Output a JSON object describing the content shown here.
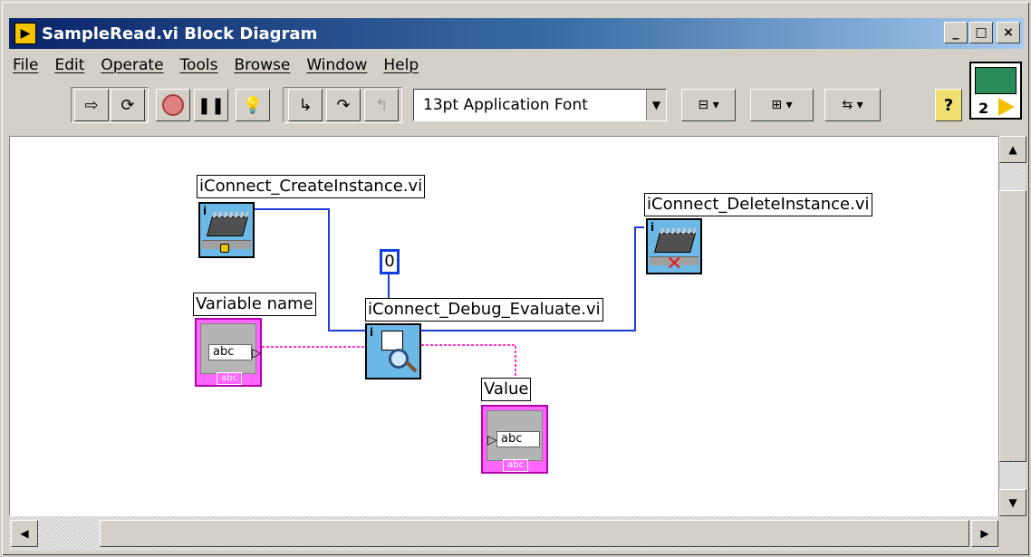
{
  "window": {
    "title": "SampleRead.vi Block Diagram",
    "controls": {
      "minimize": "_",
      "maximize": "□",
      "close": "×"
    }
  },
  "menu": [
    "File",
    "Edit",
    "Operate",
    "Tools",
    "Browse",
    "Window",
    "Help"
  ],
  "toolbar": {
    "run_icon": "run-arrow-icon",
    "run_continuous_icon": "run-continuously-icon",
    "abort_icon": "abort-icon",
    "pause_icon": "pause-icon",
    "highlight_icon": "highlight-execution-icon",
    "step_into_icon": "step-into-icon",
    "step_over_icon": "step-over-icon",
    "step_out_icon": "step-out-icon",
    "font_select": "13pt Application Font",
    "align_icon": "align-objects-icon",
    "distribute_icon": "distribute-objects-icon",
    "reorder_icon": "reorder-icon",
    "help_label": "?"
  },
  "vi_icon": {
    "number": "2"
  },
  "diagram": {
    "create_label": "iConnect_CreateInstance.vi",
    "delete_label": "iConnect_DeleteInstance.vi",
    "evaluate_label": "iConnect_Debug_Evaluate.vi",
    "var_label": "Variable name",
    "value_label": "Value",
    "constant_value": "0",
    "abc_text": "abc",
    "abc_tag": "abc"
  },
  "colors": {
    "title_start": "#0a246a",
    "reference_wire": "#1e3cd8",
    "string_wire": "#ff33cc",
    "string_terminal": "#ff66ff"
  }
}
